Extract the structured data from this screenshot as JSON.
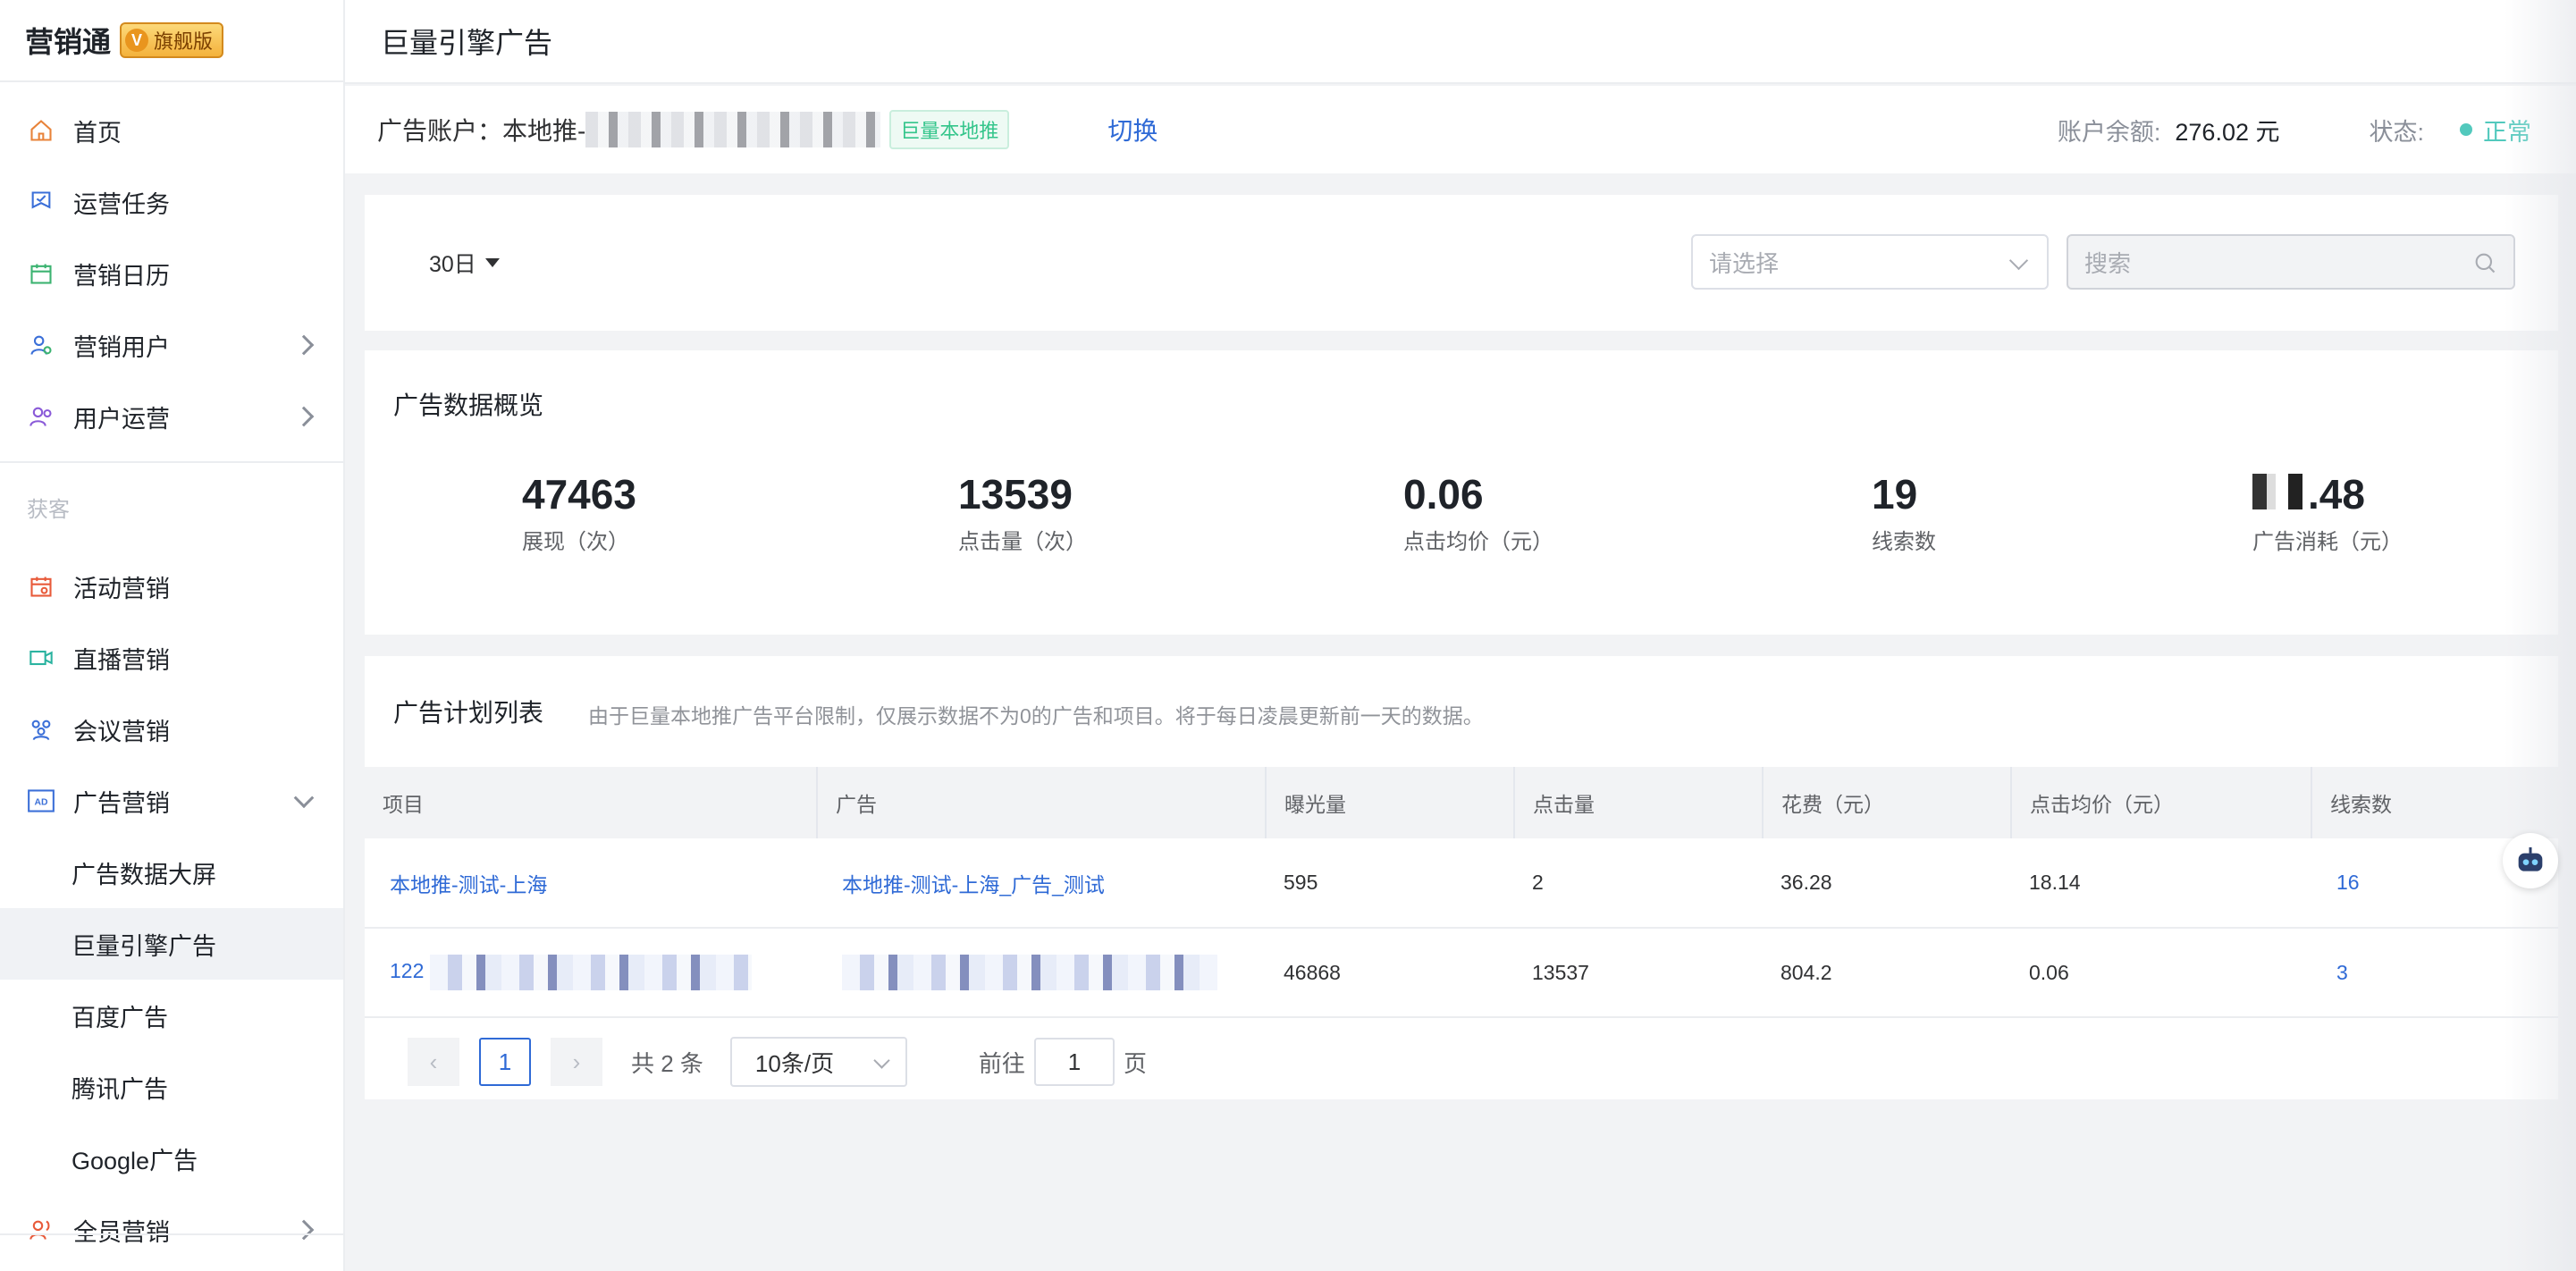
{
  "brand": {
    "title": "营销通",
    "badge": "旗舰版",
    "badge_mark": "V"
  },
  "sidebar": {
    "items": [
      {
        "label": "首页"
      },
      {
        "label": "运营任务"
      },
      {
        "label": "营销日历"
      },
      {
        "label": "营销用户"
      },
      {
        "label": "用户运营"
      }
    ],
    "group_label": "获客",
    "acquire_items": [
      {
        "label": "活动营销"
      },
      {
        "label": "直播营销"
      },
      {
        "label": "会议营销"
      },
      {
        "label": "广告营销"
      }
    ],
    "ad_sub_items": [
      {
        "label": "广告数据大屏"
      },
      {
        "label": "巨量引擎广告"
      },
      {
        "label": "百度广告"
      },
      {
        "label": "腾讯广告"
      },
      {
        "label": "Google广告"
      }
    ],
    "last_item": {
      "label": "全员营销"
    }
  },
  "header": {
    "title": "巨量引擎广告"
  },
  "account": {
    "label": "广告账户：",
    "name_prefix": "本地推-",
    "tag": "巨量本地推",
    "switch_label": "切换",
    "balance_label": "账户余额:",
    "balance_value": "276.02 元",
    "status_label": "状态:",
    "status_value": "正常"
  },
  "filter": {
    "period": "30日",
    "select_placeholder": "请选择",
    "search_placeholder": "搜索"
  },
  "overview": {
    "title": "广告数据概览",
    "metrics": [
      {
        "value": "47463",
        "label": "展现（次）"
      },
      {
        "value": "13539",
        "label": "点击量（次）"
      },
      {
        "value": "0.06",
        "label": "点击均价（元）"
      },
      {
        "value": "19",
        "label": "线索数"
      },
      {
        "value": ".48",
        "label": "广告消耗（元）"
      }
    ]
  },
  "plans": {
    "title": "广告计划列表",
    "note": "由于巨量本地推广告平台限制，仅展示数据不为0的广告和项目。将于每日凌晨更新前一天的数据。",
    "columns": [
      "项目",
      "广告",
      "曝光量",
      "点击量",
      "花费（元）",
      "点击均价（元）",
      "线索数"
    ],
    "rows": [
      {
        "project": "本地推-测试-上海",
        "ad": "本地推-测试-上海_广告_测试",
        "impressions": "595",
        "clicks": "2",
        "cost": "36.28",
        "cpc": "18.14",
        "leads": "16"
      },
      {
        "project": "122",
        "ad": "",
        "impressions": "46868",
        "clicks": "13537",
        "cost": "804.2",
        "cpc": "0.06",
        "leads": "3"
      }
    ],
    "pager": {
      "prev": "‹",
      "next": "›",
      "current_page": "1",
      "total": "共 2 条",
      "page_size": "10条/页",
      "goto_label": "前往",
      "goto_value": "1",
      "page_unit": "页"
    }
  }
}
